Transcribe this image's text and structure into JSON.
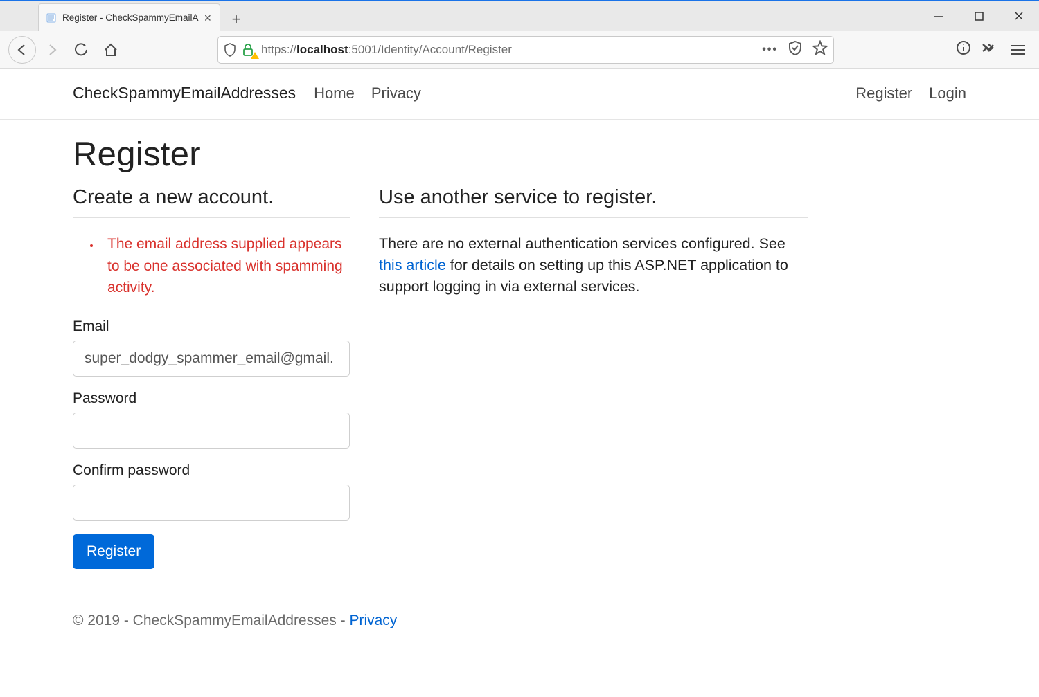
{
  "browser": {
    "tab_title": "Register - CheckSpammyEmailA",
    "url_prefix": "https://",
    "url_host": "localhost",
    "url_suffix": ":5001/Identity/Account/Register"
  },
  "nav": {
    "brand": "CheckSpammyEmailAddresses",
    "links": [
      "Home",
      "Privacy"
    ],
    "auth": [
      "Register",
      "Login"
    ]
  },
  "page": {
    "title": "Register",
    "left_heading": "Create a new account.",
    "right_heading": "Use another service to register.",
    "validation_errors": [
      "The email address supplied appears to be one associated with spamming activity."
    ],
    "form": {
      "email_label": "Email",
      "email_value": "super_dodgy_spammer_email@gmail.",
      "password_label": "Password",
      "password_value": "",
      "confirm_label": "Confirm password",
      "confirm_value": "",
      "submit_label": "Register"
    },
    "external": {
      "text_before": "There are no external authentication services configured. See ",
      "link_text": "this article",
      "text_after": " for details on setting up this ASP.NET application to support logging in via external services."
    }
  },
  "footer": {
    "text": "© 2019 - CheckSpammyEmailAddresses - ",
    "privacy_label": "Privacy"
  }
}
